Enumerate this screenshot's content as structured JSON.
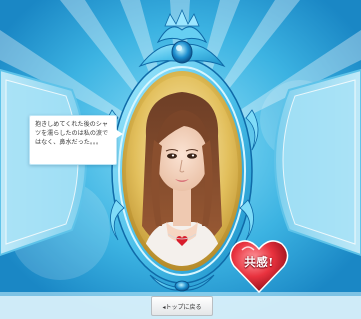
{
  "message": {
    "text": "抱きしめてくれた後のシャツを濡らしたのは私の涙ではなく、鼻水だった。。。"
  },
  "empathy_button": {
    "label": "共感!",
    "color": "#e8323e"
  },
  "back_button": {
    "label": "◂トップに戻る"
  },
  "colors": {
    "background": "#2fa9de",
    "frame": "#6cd3f3",
    "frame_dark": "#1a8fc8"
  }
}
